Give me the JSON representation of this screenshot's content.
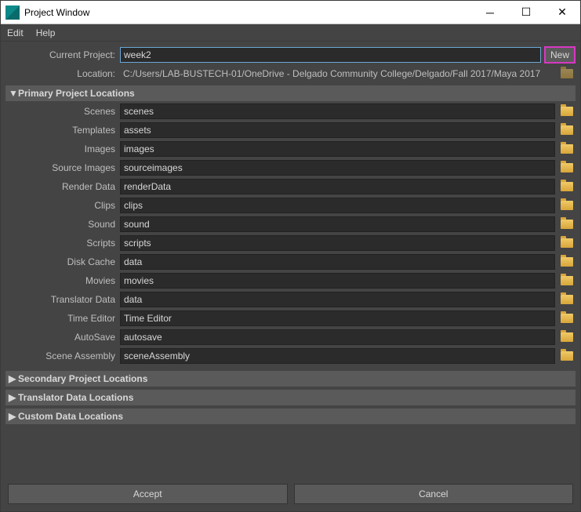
{
  "window": {
    "title": "Project Window"
  },
  "menu": {
    "edit": "Edit",
    "help": "Help"
  },
  "header": {
    "currentProjectLabel": "Current Project:",
    "currentProjectValue": "week2",
    "newButton": "New",
    "locationLabel": "Location:",
    "locationValue": "C:/Users/LAB-BUSTECH-01/OneDrive - Delgado Community College/Delgado/Fall 2017/Maya 2017"
  },
  "sections": {
    "primary": {
      "title": "Primary Project Locations",
      "fields": [
        {
          "label": "Scenes",
          "value": "scenes"
        },
        {
          "label": "Templates",
          "value": "assets"
        },
        {
          "label": "Images",
          "value": "images"
        },
        {
          "label": "Source Images",
          "value": "sourceimages"
        },
        {
          "label": "Render Data",
          "value": "renderData"
        },
        {
          "label": "Clips",
          "value": "clips"
        },
        {
          "label": "Sound",
          "value": "sound"
        },
        {
          "label": "Scripts",
          "value": "scripts"
        },
        {
          "label": "Disk Cache",
          "value": "data"
        },
        {
          "label": "Movies",
          "value": "movies"
        },
        {
          "label": "Translator Data",
          "value": "data"
        },
        {
          "label": "Time Editor",
          "value": "Time Editor"
        },
        {
          "label": "AutoSave",
          "value": "autosave"
        },
        {
          "label": "Scene Assembly",
          "value": "sceneAssembly"
        }
      ]
    },
    "secondary": {
      "title": "Secondary Project Locations"
    },
    "translator": {
      "title": "Translator Data Locations"
    },
    "custom": {
      "title": "Custom Data Locations"
    }
  },
  "footer": {
    "accept": "Accept",
    "cancel": "Cancel"
  }
}
